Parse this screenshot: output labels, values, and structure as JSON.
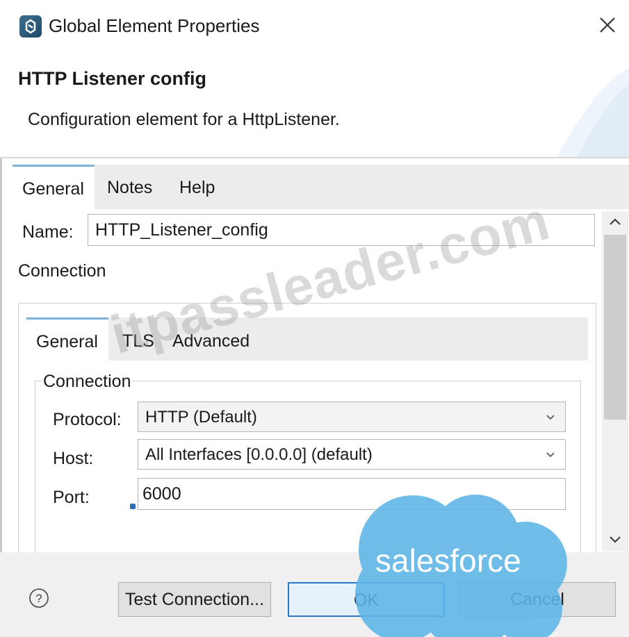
{
  "window": {
    "title": "Global Element Properties",
    "close_icon": "close-icon"
  },
  "header": {
    "title": "HTTP Listener config",
    "description": "Configuration element for a HttpListener."
  },
  "outer_tabs": [
    {
      "label": "General",
      "selected": true
    },
    {
      "label": "Notes",
      "selected": false
    },
    {
      "label": "Help",
      "selected": false
    }
  ],
  "form": {
    "name_label": "Name:",
    "name_value": "HTTP_Listener_config",
    "connection_label": "Connection"
  },
  "inner_tabs": [
    {
      "label": "General",
      "selected": true
    },
    {
      "label": "TLS",
      "selected": false
    },
    {
      "label": "Advanced",
      "selected": false
    }
  ],
  "connection": {
    "group_title": "Connection",
    "protocol_label": "Protocol:",
    "protocol_value": "HTTP (Default)",
    "host_label": "Host:",
    "host_value": "All Interfaces [0.0.0.0] (default)",
    "port_label": "Port:",
    "port_value": "6000"
  },
  "buttons": {
    "help": "?",
    "test_connection": "Test Connection...",
    "ok": "OK",
    "cancel": "Cancel"
  },
  "overlays": {
    "watermark": "itpassleader.com",
    "logo_text": "salesforce"
  },
  "colors": {
    "accent": "#2a78c9",
    "tab_highlight": "#7fb2d8",
    "salesforce_blue": "#5db5e8"
  }
}
